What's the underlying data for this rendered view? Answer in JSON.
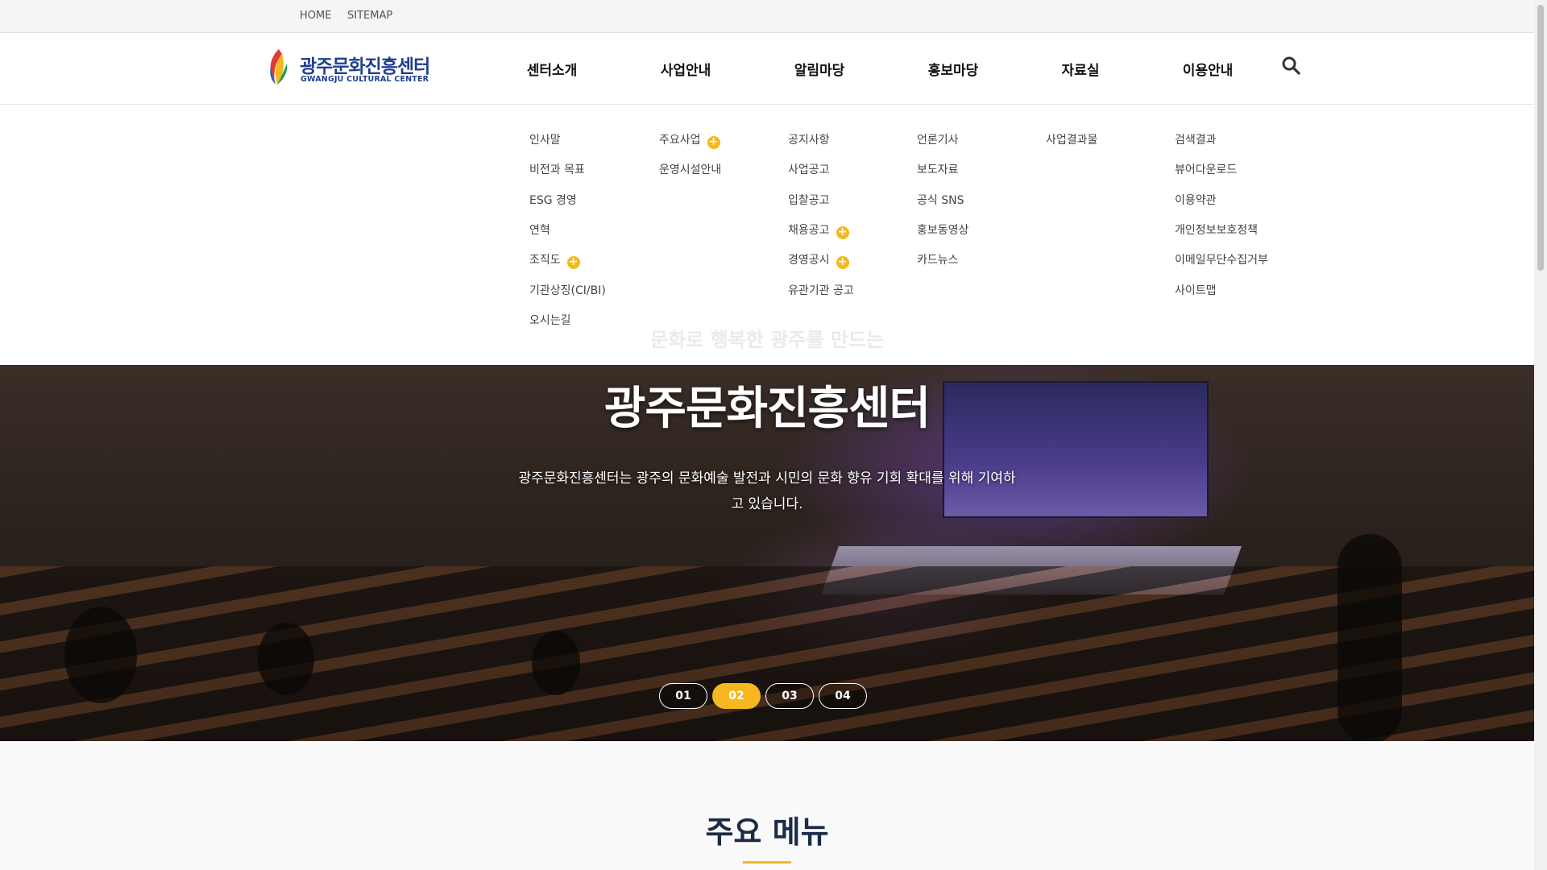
{
  "util": {
    "home": "HOME",
    "sitemap": "SITEMAP"
  },
  "logo": {
    "ko": "광주문화진흥센터",
    "en": "GWANGJU CULTURAL CENTER"
  },
  "gnb": [
    "센터소개",
    "사업안내",
    "알림마당",
    "홍보마당",
    "자료실",
    "이용안내"
  ],
  "submenu": {
    "col1": [
      "인사말",
      "비전과 목표",
      "ESG 경영",
      "연혁",
      "조직도",
      "기관상징(CI/BI)",
      "오시는길"
    ],
    "col2": [
      "주요사업",
      "운영시설안내"
    ],
    "col3": [
      "공지사항",
      "사업공고",
      "입찰공고",
      "채용공고",
      "경영공시",
      "유관기관 공고"
    ],
    "col4": [
      "언론기사",
      "보도자료",
      "공식 SNS",
      "홍보동영상",
      "카드뉴스"
    ],
    "col5": [
      "사업결과물"
    ],
    "col6": [
      "검색결과",
      "뷰어다운로드",
      "이용약관",
      "개인정보보호정책",
      "이메일무단수집거부",
      "사이트맵"
    ]
  },
  "hero": {
    "ghost": "문화로 행복한 광주를 만드는",
    "title": "광주문화진흥센터",
    "desc": "광주문화진흥센터는 광주의 문화예술 발전과 시민의 문화 향유 기회 확대를 위해 기여하고 있습니다.",
    "pages": [
      "01",
      "02",
      "03",
      "04"
    ],
    "active_page": "02"
  },
  "main": {
    "title": "주요 메뉴"
  },
  "colors": {
    "accent": "#f6b820",
    "brand": "#223f8f",
    "heading": "#1b2b48"
  },
  "icons": {
    "search": "search-icon",
    "plus": "plus-icon",
    "logo": "logo-mark-icon"
  }
}
